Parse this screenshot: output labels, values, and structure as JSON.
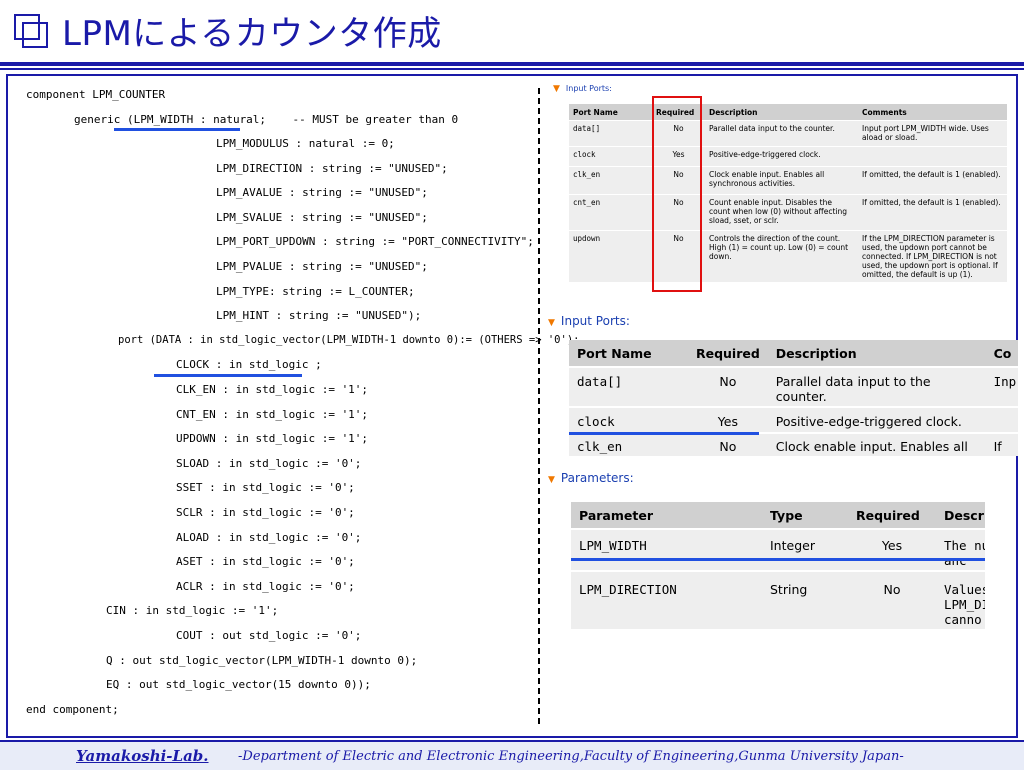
{
  "header": {
    "title": "LPMによるカウンタ作成"
  },
  "code_lines": [
    "component LPM_COUNTER",
    "generic (LPM_WIDTH : natural;    -- MUST be greater than 0",
    "LPM_MODULUS : natural := 0;",
    "LPM_DIRECTION : string := \"UNUSED\";",
    "LPM_AVALUE : string := \"UNUSED\";",
    "LPM_SVALUE : string := \"UNUSED\";",
    "LPM_PORT_UPDOWN : string := \"PORT_CONNECTIVITY\";",
    "LPM_PVALUE : string := \"UNUSED\";",
    "LPM_TYPE: string := L_COUNTER;",
    "LPM_HINT : string := \"UNUSED\");",
    "port (DATA : in std_logic_vector(LPM_WIDTH-1 downto 0):= (OTHERS => '0');",
    "CLOCK : in std_logic ;",
    "CLK_EN : in std_logic := '1';",
    "CNT_EN : in std_logic := '1';",
    "UPDOWN : in std_logic := '1';",
    "SLOAD : in std_logic := '0';",
    "SSET : in std_logic := '0';",
    "SCLR : in std_logic := '0';",
    "ALOAD : in std_logic := '0';",
    "ASET : in std_logic := '0';",
    "ACLR : in std_logic := '0';",
    "CIN : in std_logic := '1';",
    "COUT : out std_logic := '0';",
    "Q : out std_logic_vector(LPM_WIDTH-1 downto 0);",
    "EQ : out std_logic_vector(15 downto 0));",
    "end component;"
  ],
  "small_table": {
    "section": "Input Ports:",
    "headers": [
      "Port Name",
      "Required",
      "Description",
      "Comments"
    ],
    "rows": [
      [
        "data[]",
        "No",
        "Parallel data input to the counter.",
        "Input port LPM_WIDTH wide. Uses aload or sload."
      ],
      [
        "clock",
        "Yes",
        "Positive-edge-triggered clock.",
        ""
      ],
      [
        "clk_en",
        "No",
        "Clock enable input. Enables all synchronous activities.",
        "If omitted, the default is 1 (enabled)."
      ],
      [
        "cnt_en",
        "No",
        "Count enable input. Disables the count when low (0) without affecting sload, sset, or sclr.",
        "If omitted, the default is 1 (enabled)."
      ],
      [
        "updown",
        "No",
        "Controls the direction of the count. High (1) = count up. Low (0) = count down.",
        "If the LPM_DIRECTION parameter is used, the updown port cannot be connected. If LPM_DIRECTION is not used, the updown port is optional. If omitted, the default is up (1)."
      ]
    ]
  },
  "big_ports": {
    "section": "Input Ports:",
    "headers": [
      "Port Name",
      "Required",
      "Description",
      "Co"
    ],
    "rows": [
      [
        "data[]",
        "No",
        "Parallel data input to the counter.",
        "Inp al"
      ],
      [
        "clock",
        "Yes",
        "Positive-edge-triggered clock.",
        ""
      ],
      [
        "clk_en",
        "No",
        "Clock enable input. Enables all",
        "If"
      ]
    ]
  },
  "big_params": {
    "section": "Parameters:",
    "headers": [
      "Parameter",
      "Type",
      "Required",
      "Descr"
    ],
    "rows": [
      [
        "LPM_WIDTH",
        "Integer",
        "Yes",
        "The nu [] anc"
      ],
      [
        "LPM_DIRECTION",
        "String",
        "No",
        "Values LPM_DI canno"
      ]
    ]
  },
  "footer": {
    "lab": "Yamakoshi-Lab.",
    "dept": "-Department of Electric and Electronic Engineering,Faculty of Engineering,Gunma University Japan-"
  },
  "colors": {
    "accent": "#1a1aa8",
    "highlight_line": "#2050e0",
    "red_box": "#e01010",
    "section_arrow": "#f07800"
  }
}
